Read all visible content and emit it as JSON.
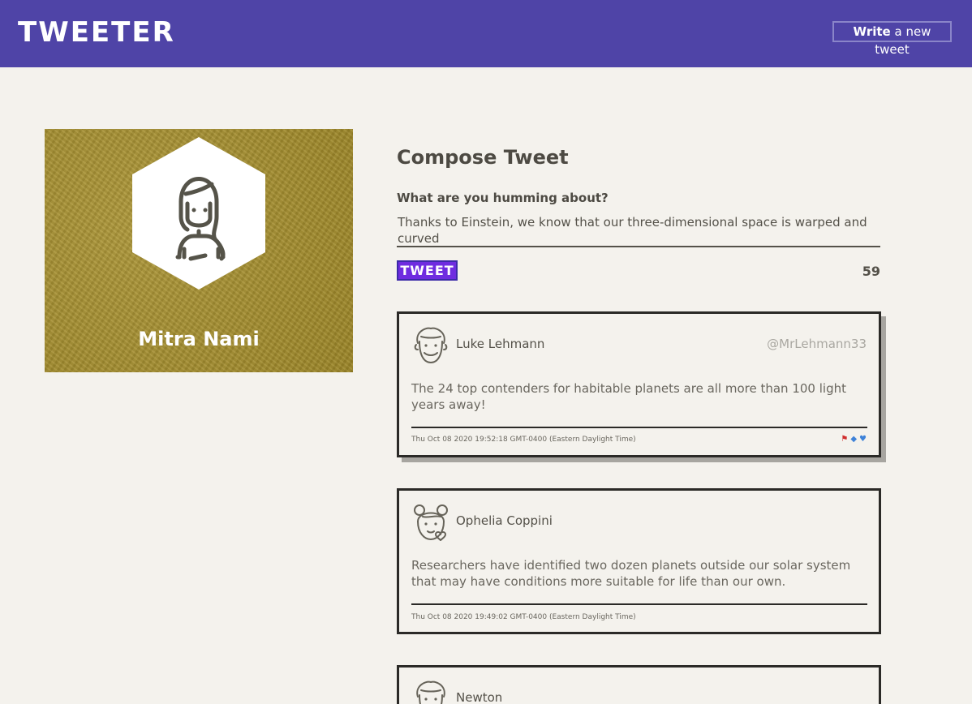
{
  "nav": {
    "brand": "TWEETER",
    "write_strong": "Write",
    "write_rest": " a new tweet"
  },
  "profile": {
    "name": "Mitra Nami",
    "avatar_icon": "woman-avatar-icon"
  },
  "compose": {
    "title": "Compose Tweet",
    "label": "What are you humming about?",
    "text": "Thanks to Einstein, we know that our three-dimensional space is warped and curved",
    "button": "TWEET",
    "counter": "59"
  },
  "tweets": [
    {
      "name": "Luke Lehmann",
      "handle": "@MrLehmann33",
      "body": "The 24 top contenders for habitable planets are all more than 100 light years away!",
      "date": "Thu Oct 08 2020 19:52:18 GMT-0400 (Eastern Daylight Time)",
      "avatar_icon": "man-avatar-icon",
      "actions": [
        "flag-icon",
        "retweet-icon",
        "heart-icon"
      ]
    },
    {
      "name": "Ophelia Coppini",
      "handle": "",
      "body": "Researchers have identified two dozen planets outside our solar system that may have conditions more suitable for life than our own.",
      "date": "Thu Oct 08 2020 19:49:02 GMT-0400 (Eastern Daylight Time)",
      "avatar_icon": "girl-avatar-icon"
    },
    {
      "name": "Newton",
      "avatar_icon": "man-avatar-icon"
    }
  ],
  "colors": {
    "nav_bg": "#4f44a7",
    "page_bg": "#f4f2ed",
    "profile_bg": "#a8902a",
    "tweet_button": "#6f2ce0",
    "text": "#545149"
  }
}
